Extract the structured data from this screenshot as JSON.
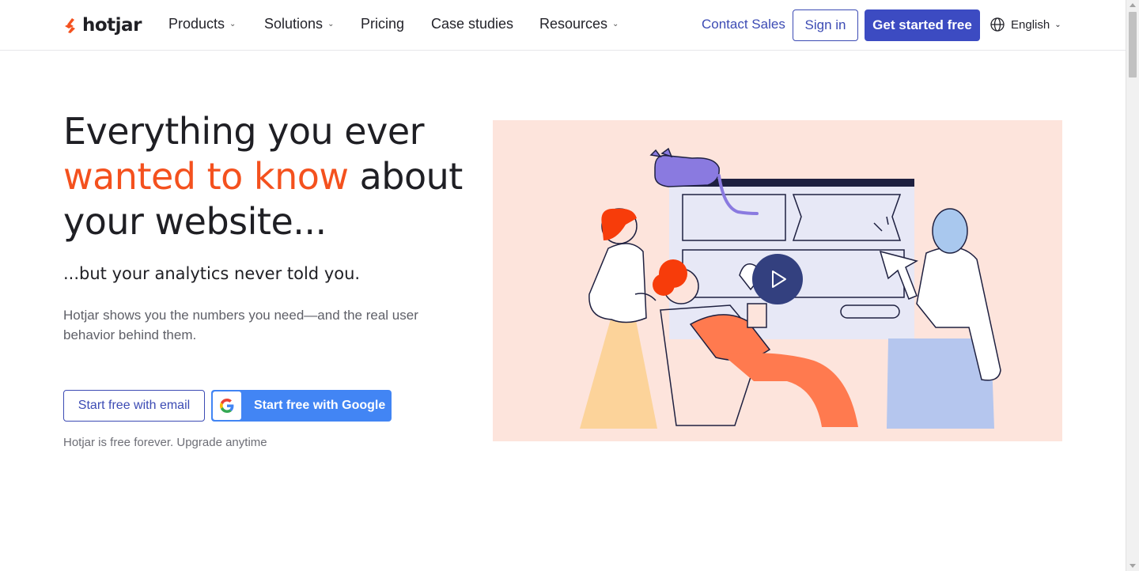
{
  "brand": {
    "name": "hotjar",
    "color": "#f4511e",
    "logo_icon": "hotjar-logo-icon"
  },
  "nav": {
    "items": [
      {
        "label": "Products",
        "has_dropdown": true
      },
      {
        "label": "Solutions",
        "has_dropdown": true
      },
      {
        "label": "Pricing",
        "has_dropdown": false
      },
      {
        "label": "Case studies",
        "has_dropdown": false
      },
      {
        "label": "Resources",
        "has_dropdown": true
      }
    ],
    "dropdown_icon": "⌄",
    "contact_sales": "Contact Sales",
    "sign_in": "Sign in",
    "get_started": "Get started free",
    "language": "English",
    "language_icon": "globe-icon"
  },
  "hero": {
    "headline_part1": "Everything you ever",
    "headline_accent": "wanted to know",
    "headline_part2": "about your website...",
    "subheadline": "...but your analytics never told you.",
    "description": "Hotjar shows you the numbers you need—and the real user behavior behind them.",
    "cta_email": "Start free with email",
    "cta_google": "Start free with Google",
    "note": "Hotjar is free forever. Upgrade anytime",
    "video_icon": "play-icon"
  },
  "colors": {
    "primary": "#3c4bc2",
    "accent": "#f4511e",
    "google_blue": "#4285f4",
    "hero_background": "#fde4dc",
    "play_button": "#33407f"
  }
}
